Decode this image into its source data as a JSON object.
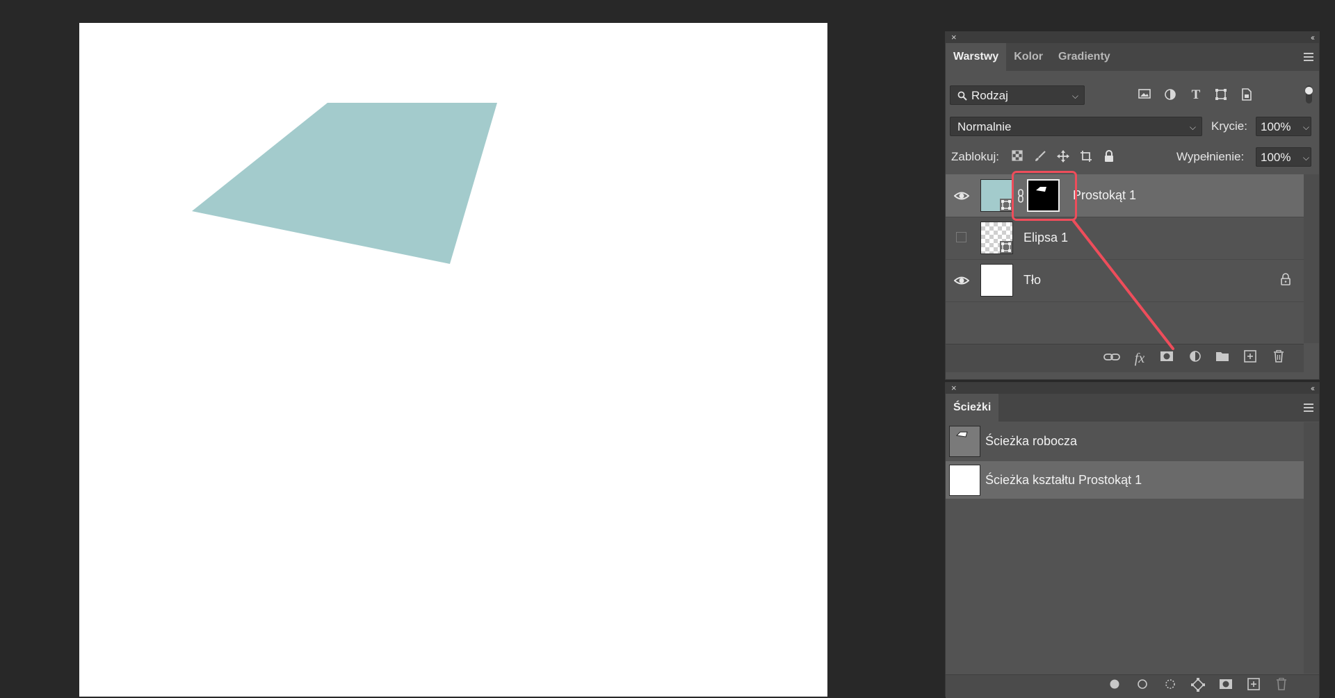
{
  "canvas": {
    "background": "#ffffff",
    "shape_color": "#a3cbcc"
  },
  "layers_panel": {
    "tabs": [
      {
        "label": "Warstwy",
        "active": true
      },
      {
        "label": "Kolor",
        "active": false
      },
      {
        "label": "Gradienty",
        "active": false
      }
    ],
    "filter": {
      "label": "Rodzaj",
      "icon": "search-icon"
    },
    "filter_icons": [
      "image-filter-icon",
      "adjustment-filter-icon",
      "type-filter-icon",
      "shape-filter-icon",
      "smart-object-filter-icon"
    ],
    "blend_mode": "Normalnie",
    "opacity_label": "Krycie:",
    "opacity_value": "100%",
    "lock_label": "Zablokuj:",
    "fill_label": "Wypełnienie:",
    "fill_value": "100%",
    "layers": [
      {
        "name": "Prostokąt 1",
        "visible": true,
        "selected": true,
        "thumb_color": "#a3cbcc",
        "has_mask": true
      },
      {
        "name": "Elipsa 1",
        "visible": false,
        "selected": false,
        "thumb": "transparent"
      },
      {
        "name": "Tło",
        "visible": true,
        "selected": false,
        "thumb_color": "#ffffff",
        "locked": true
      }
    ],
    "footer_icons": [
      "link-icon",
      "fx-icon",
      "add-mask-icon",
      "adjustment-layer-icon",
      "new-group-icon",
      "new-layer-icon",
      "trash-icon"
    ]
  },
  "paths_panel": {
    "tab": "Ścieżki",
    "paths": [
      {
        "name": "Ścieżka robocza",
        "selected": false
      },
      {
        "name": "Ścieżka kształtu Prostokąt 1",
        "selected": true
      }
    ],
    "footer_icons": [
      "fill-path-icon",
      "stroke-path-icon",
      "load-selection-icon",
      "make-path-icon",
      "add-mask-icon",
      "new-path-icon",
      "trash-icon"
    ]
  },
  "annotation": {
    "color": "#ee4d5b"
  }
}
